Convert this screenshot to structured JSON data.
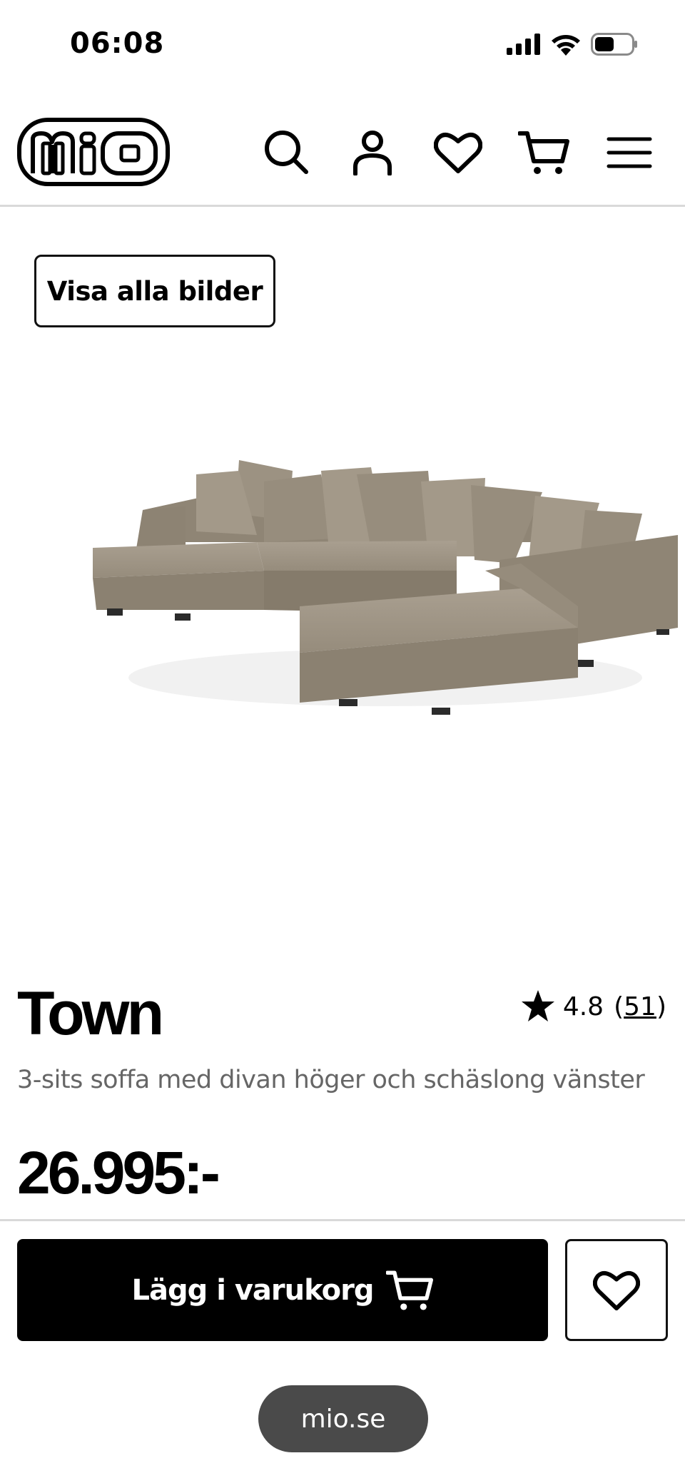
{
  "status_bar": {
    "time": "06:08",
    "icons": [
      "cellular-signal-icon",
      "wifi-icon",
      "battery-icon"
    ]
  },
  "header": {
    "logo_text": "mio",
    "icons": [
      "search-icon",
      "account-icon",
      "wishlist-heart-icon",
      "cart-icon",
      "menu-icon"
    ]
  },
  "gallery": {
    "show_all_label": "Visa alla bilder"
  },
  "product": {
    "name": "Town",
    "subtitle": "3-sits soffa med divan höger och schäslong vänster",
    "price": "26.995:-",
    "rating": {
      "score": "4.8",
      "open_paren": "(",
      "count": "51",
      "close_paren": ")"
    }
  },
  "actions": {
    "add_to_cart_label": "Lägg i varukorg"
  },
  "browser": {
    "url": "mio.se"
  },
  "colors": {
    "primary": "#000000",
    "background": "#ffffff",
    "muted_text": "#666666",
    "divider": "#d9d9d9",
    "sofa": "#9a9080",
    "url_pill": "#4a4a4a"
  }
}
